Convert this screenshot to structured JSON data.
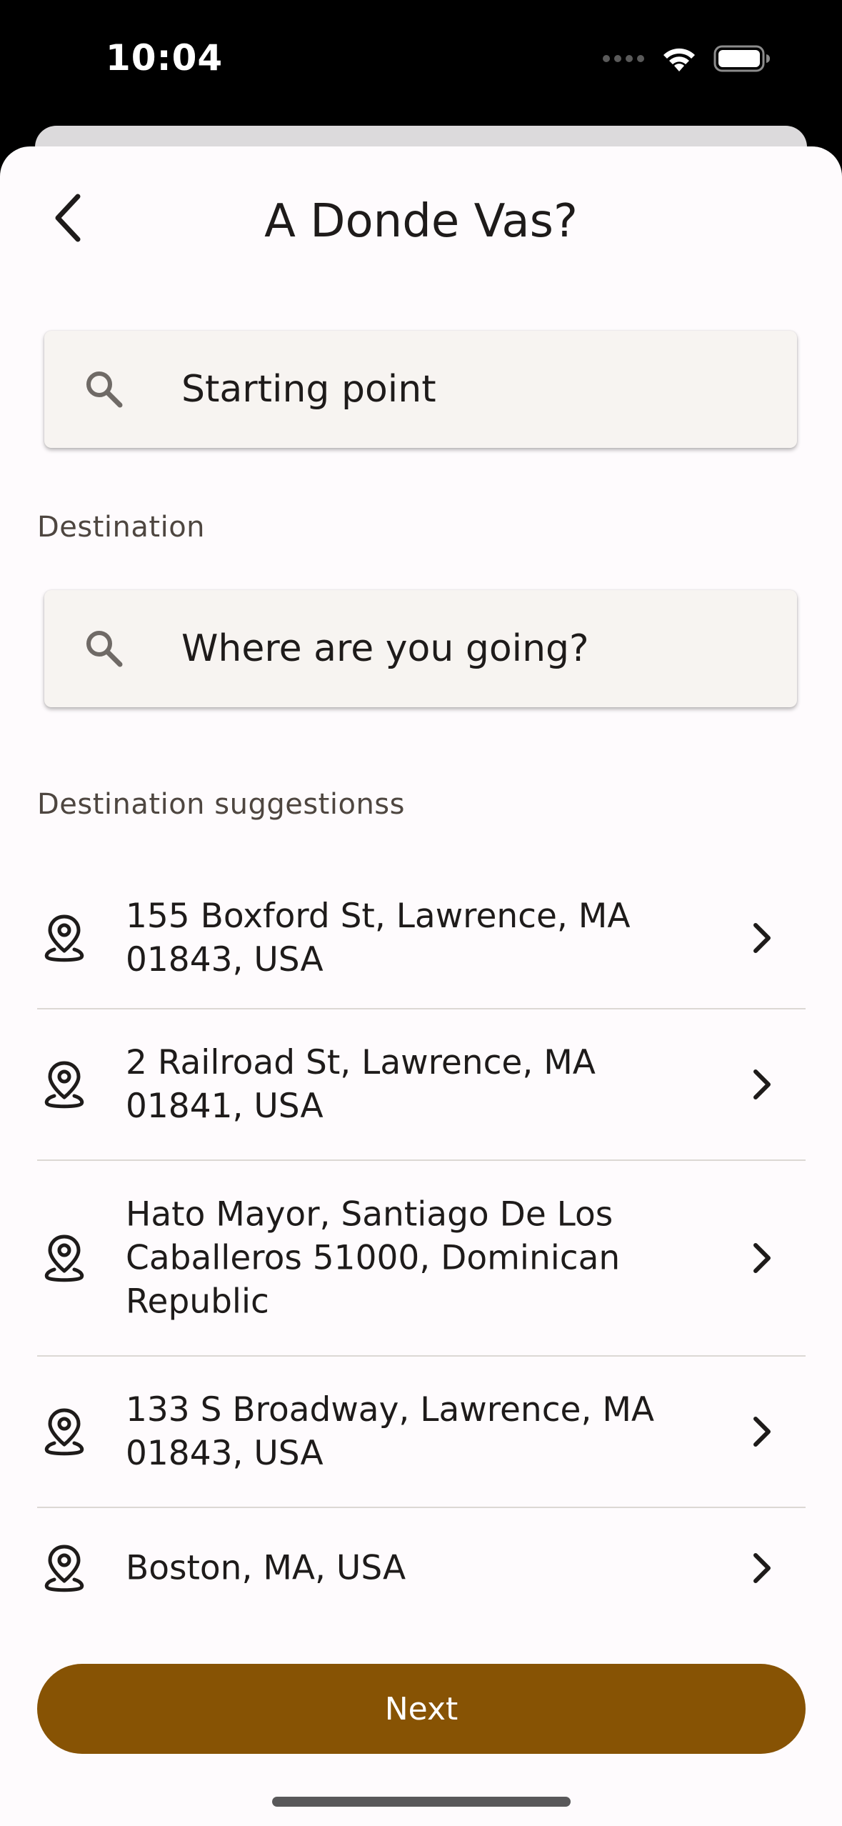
{
  "status_bar": {
    "time": "10:04"
  },
  "header": {
    "title": "A Donde Vas?",
    "back_icon": "chevron-left-icon"
  },
  "starting_point": {
    "placeholder": "Starting point",
    "icon": "search-icon"
  },
  "destination": {
    "label": "Destination",
    "placeholder": "Where are you going?",
    "icon": "search-icon"
  },
  "suggestions": {
    "label": "Destination suggestionss",
    "items": [
      {
        "address": "155 Boxford St, Lawrence, MA 01843, USA"
      },
      {
        "address": "2 Railroad St, Lawrence, MA 01841, USA"
      },
      {
        "address": "Hato Mayor, Santiago De Los Caballeros 51000, Dominican Republic"
      },
      {
        "address": "133 S Broadway, Lawrence, MA 01843, USA"
      },
      {
        "address": "Boston, MA, USA"
      }
    ]
  },
  "actions": {
    "next_label": "Next"
  },
  "colors": {
    "accent": "#875304",
    "background": "#fefbfd",
    "field": "#f7f4f1",
    "text": "#1e1b1a"
  }
}
